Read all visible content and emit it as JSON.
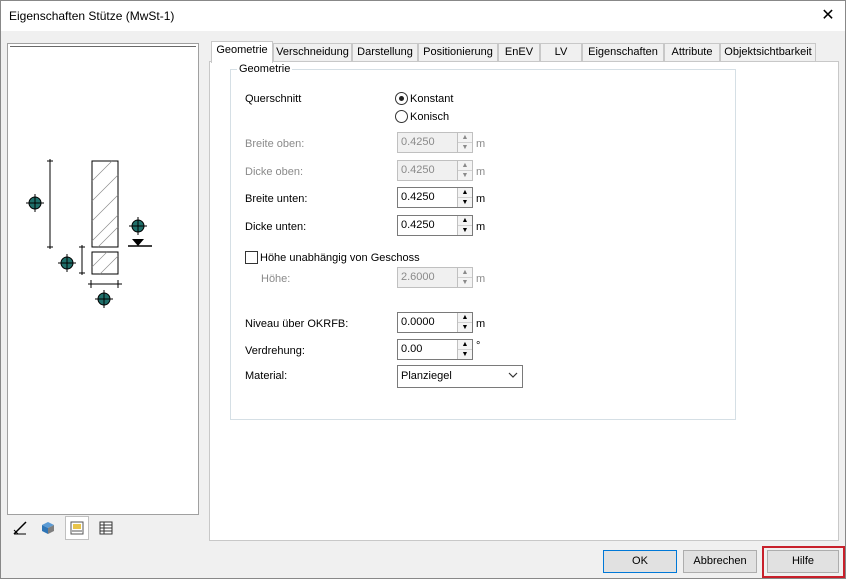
{
  "window": {
    "title": "Eigenschaften Stütze (MwSt-1)",
    "close_glyph": "✕"
  },
  "tabs": [
    "Geometrie",
    "Verschneidung",
    "Darstellung",
    "Positionierung",
    "EnEV",
    "LV",
    "Eigenschaften",
    "Attribute",
    "Objektsichtbarkeit"
  ],
  "group": {
    "legend": "Geometrie"
  },
  "querschnitt": {
    "label": "Querschnitt",
    "options": [
      "Konstant",
      "Konisch"
    ],
    "selected": "Konstant"
  },
  "fields": {
    "breite_oben": {
      "label": "Breite oben:",
      "value": "0.4250",
      "unit": "m",
      "enabled": false
    },
    "dicke_oben": {
      "label": "Dicke oben:",
      "value": "0.4250",
      "unit": "m",
      "enabled": false
    },
    "breite_unten": {
      "label": "Breite unten:",
      "value": "0.4250",
      "unit": "m",
      "enabled": true
    },
    "dicke_unten": {
      "label": "Dicke unten:",
      "value": "0.4250",
      "unit": "m",
      "enabled": true
    },
    "hoehe": {
      "label": "Höhe:",
      "value": "2.6000",
      "unit": "m",
      "enabled": false
    },
    "niveau": {
      "label": "Niveau über OKRFB:",
      "value": "0.0000",
      "unit": "m",
      "enabled": true
    },
    "verdrehung": {
      "label": "Verdrehung:",
      "value": "0.00",
      "unit": "°",
      "enabled": true
    }
  },
  "hoehe_unabhaengig": {
    "label": "Höhe unabhängig von Geschoss",
    "checked": false
  },
  "material": {
    "label": "Material:",
    "value": "Planziegel"
  },
  "buttons": {
    "ok": "OK",
    "cancel": "Abbrechen",
    "help": "Hilfe"
  },
  "preview_toolbar": [
    "edit-icon",
    "3d-box-icon",
    "plan-view-icon",
    "table-icon"
  ],
  "colors": {
    "accent": "#0078d7",
    "highlight": "#c8202b",
    "marker": "#1f6f6a"
  }
}
